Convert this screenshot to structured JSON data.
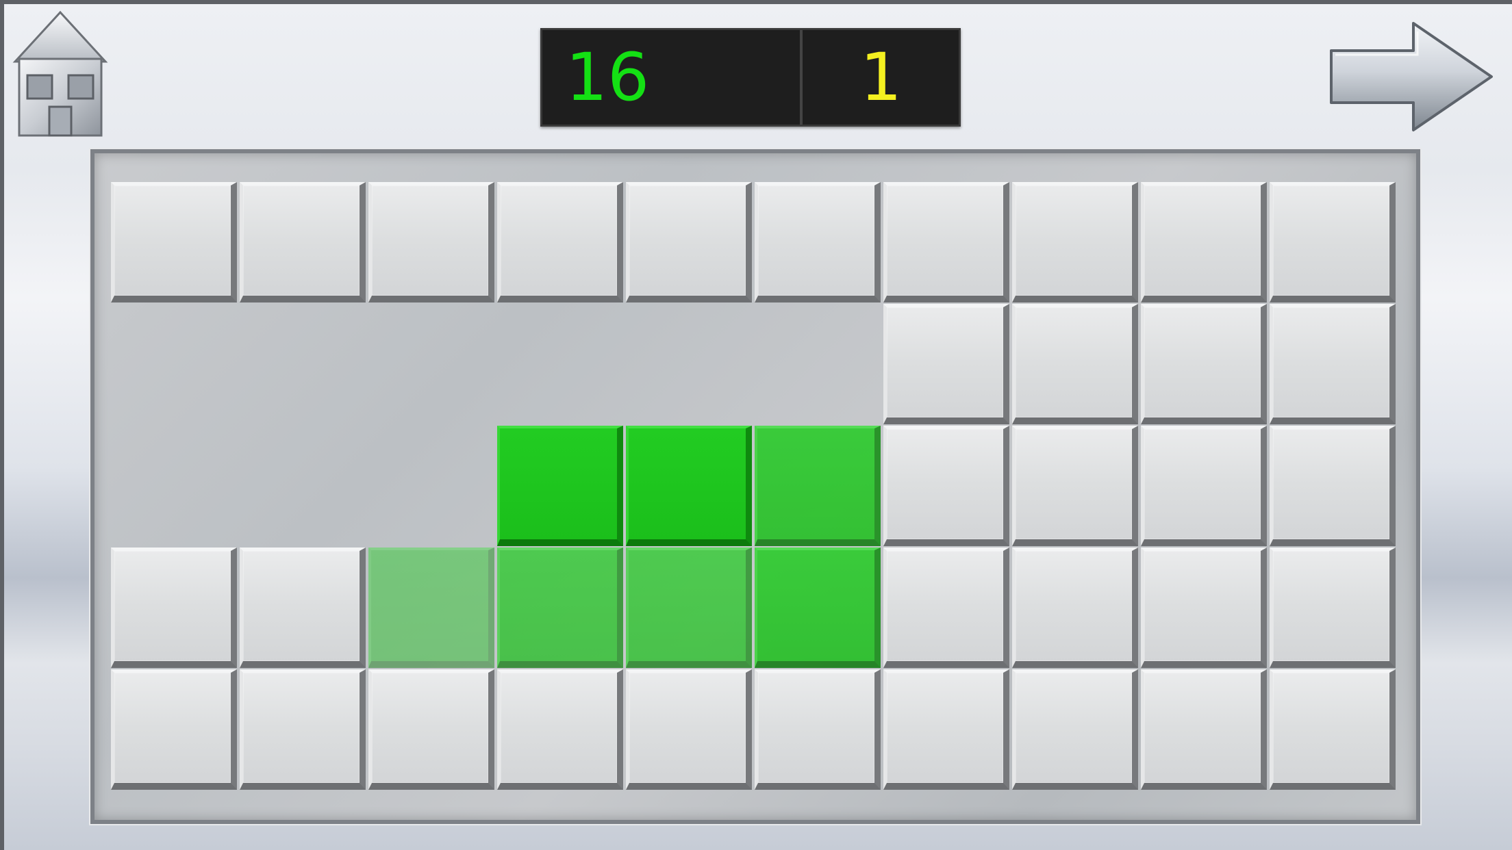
{
  "header": {
    "score_left": "16",
    "score_right": "1",
    "score_left_color": "#14e014",
    "score_right_color": "#f4f020"
  },
  "icons": {
    "home": "home-icon",
    "next": "arrow-right-icon"
  },
  "board": {
    "columns": 10,
    "rows": 5,
    "tile_color": "#dcdedf",
    "highlight_color": "#1fc61f",
    "grid": [
      [
        "gray",
        "gray",
        "gray",
        "gray",
        "gray",
        "gray",
        "gray",
        "gray",
        "gray",
        "gray"
      ],
      [
        "empty",
        "empty",
        "empty",
        "empty",
        "empty",
        "empty",
        "gray",
        "gray",
        "gray",
        "gray"
      ],
      [
        "empty",
        "empty",
        "empty",
        "green",
        "green",
        "green-mid",
        "gray",
        "gray",
        "gray",
        "gray"
      ],
      [
        "gray",
        "gray",
        "green-faintest",
        "green-faint",
        "green-faint",
        "green-mid",
        "gray",
        "gray",
        "gray",
        "gray"
      ],
      [
        "gray",
        "gray",
        "gray",
        "gray",
        "gray",
        "gray",
        "gray",
        "gray",
        "gray",
        "gray"
      ]
    ]
  }
}
